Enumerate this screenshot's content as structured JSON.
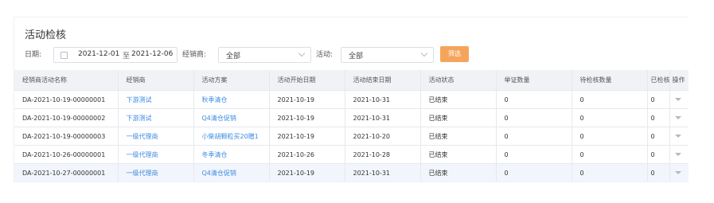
{
  "page": {
    "title": "活动检核"
  },
  "filters": {
    "date_label": "日期:",
    "date_start": "2021-12-01",
    "date_separator": "至",
    "date_end": "2021-12-06",
    "dealer_label": "经销商:",
    "dealer_value": "全部",
    "activity_label": "活动:",
    "activity_value": "全部",
    "filter_button": "筛选"
  },
  "table": {
    "headers": [
      "经销商活动名称",
      "经销商",
      "活动方案",
      "活动开始日期",
      "活动结束日期",
      "活动状态",
      "举证数量",
      "待检核数量",
      "已检核",
      "操作"
    ],
    "rows": [
      [
        "DA-2021-10-19-00000001",
        "下游测试",
        "秋季清仓",
        "2021-10-19",
        "2021-10-31",
        "已结束",
        "0",
        "0",
        "0"
      ],
      [
        "DA-2021-10-19-00000002",
        "下游测试",
        "Q4清仓促销",
        "2021-10-19",
        "2021-10-31",
        "已结束",
        "0",
        "0",
        "0"
      ],
      [
        "DA-2021-10-19-00000003",
        "一级代理商",
        "小柴胡颗粒买20赠1",
        "2021-10-19",
        "2021-10-20",
        "已结束",
        "0",
        "0",
        "0"
      ],
      [
        "DA-2021-10-26-00000001",
        "一级代理商",
        "冬季清仓",
        "2021-10-26",
        "2021-10-28",
        "已结束",
        "0",
        "0",
        "0"
      ],
      [
        "DA-2021-10-27-00000001",
        "一级代理商",
        "Q4清仓促销",
        "2021-10-19",
        "2021-10-31",
        "已结束",
        "0",
        "0",
        "0"
      ]
    ]
  },
  "colors": {
    "accent": "#f5a55b",
    "link": "#3d8be0",
    "header_bg": "#f0f2f6",
    "highlight_row": "#f2f6fc"
  },
  "icons": {
    "date": "calendar-icon",
    "select": "chevron-down-icon",
    "row_action": "caret-down-icon"
  }
}
